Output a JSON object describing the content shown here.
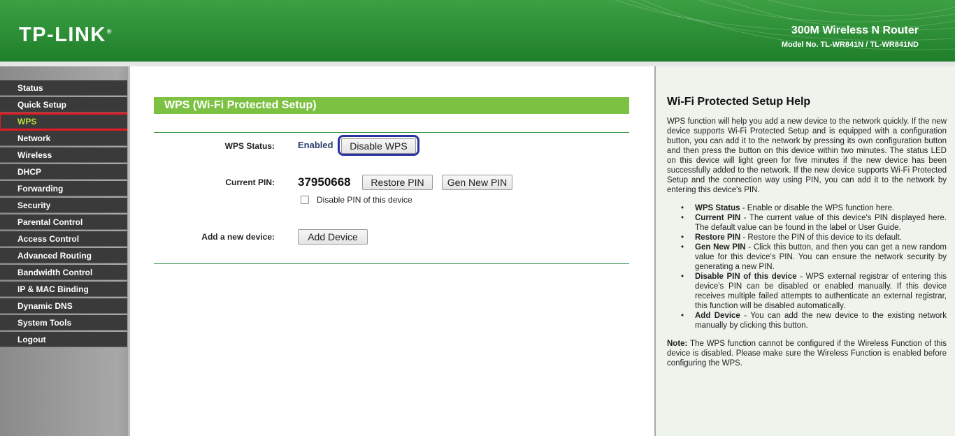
{
  "header": {
    "logo_text": "TP-LINK",
    "logo_reg": "®",
    "product": "300M Wireless N Router",
    "model": "Model No. TL-WR841N / TL-WR841ND"
  },
  "sidebar": {
    "items": [
      {
        "label": "Status"
      },
      {
        "label": "Quick Setup"
      },
      {
        "label": "WPS"
      },
      {
        "label": "Network"
      },
      {
        "label": "Wireless"
      },
      {
        "label": "DHCP"
      },
      {
        "label": "Forwarding"
      },
      {
        "label": "Security"
      },
      {
        "label": "Parental Control"
      },
      {
        "label": "Access Control"
      },
      {
        "label": "Advanced Routing"
      },
      {
        "label": "Bandwidth Control"
      },
      {
        "label": "IP & MAC Binding"
      },
      {
        "label": "Dynamic DNS"
      },
      {
        "label": "System Tools"
      },
      {
        "label": "Logout"
      }
    ],
    "active_index": 2
  },
  "main": {
    "title": "WPS (Wi-Fi Protected Setup)",
    "wps_status_label": "WPS Status:",
    "wps_status_value": "Enabled",
    "disable_wps_button": "Disable WPS",
    "current_pin_label": "Current PIN:",
    "current_pin_value": "37950668",
    "restore_pin_button": "Restore PIN",
    "gen_new_pin_button": "Gen New PIN",
    "disable_pin_checkbox_label": "Disable PIN of this device",
    "disable_pin_checked": false,
    "add_device_label": "Add a new device:",
    "add_device_button": "Add Device"
  },
  "help": {
    "title": "Wi-Fi Protected Setup Help",
    "intro": "WPS function will help you add a new device to the network quickly. If the new device supports Wi-Fi Protected Setup and is equipped with a configuration button, you can add it to the network by pressing its own configuration button and then press the button on this device within two minutes. The status LED on this device will light green for five minutes if the new device has been successfully added to the network. If the new device supports Wi-Fi Protected Setup and the connection way using PIN, you can add it to the network by entering this device's PIN.",
    "items": [
      {
        "term": "WPS Status",
        "desc": " - Enable or disable the WPS function here."
      },
      {
        "term": "Current PIN",
        "desc": " - The current value of this device's PIN displayed here. The default value can be found in the label or User Guide."
      },
      {
        "term": "Restore PIN",
        "desc": " - Restore the PIN of this device to its default."
      },
      {
        "term": "Gen New PIN",
        "desc": " - Click this button, and then you can get a new random value for this device's PIN. You can ensure the network security by generating a new PIN."
      },
      {
        "term": "Disable PIN of this device",
        "desc": " - WPS external registrar of entering this device's PIN can be disabled or enabled manually. If this device receives multiple failed attempts to authenticate an external registrar, this function will be disabled automatically."
      },
      {
        "term": "Add Device",
        "desc": " - You can add the new device to the existing network manually by clicking this button."
      }
    ],
    "note_label": "Note:",
    "note_text": " The WPS function cannot be configured if the Wireless Function of this device is disabled. Please make sure the Wireless Function is enabled before configuring the WPS."
  },
  "colors": {
    "header_green": "#2f9138",
    "menu_bg": "#3a3a3a",
    "active_text": "#b7df43",
    "active_outline": "#e31b23",
    "title_bar": "#7dc142",
    "button_highlight": "#2933a0"
  }
}
